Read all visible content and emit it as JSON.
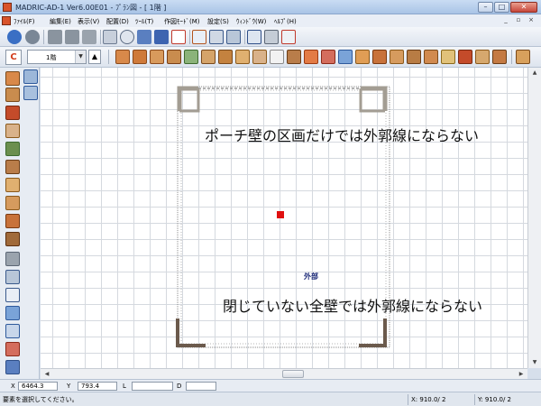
{
  "window": {
    "title": "MADRIC-AD-1 Ver6.00E01 - ﾌﾟﾗﾝ図 - [ 1階 ]",
    "minimize": "–",
    "maximize": "□",
    "close": "✕"
  },
  "menu": {
    "items": [
      "ﾌｧｲﾙ(F)",
      "編集(E)",
      "表示(V)",
      "配置(D)",
      "ﾂｰﾙ(T)",
      "作図ﾓｰﾄﾞ(M)",
      "設定(S)",
      "ｳｨﾝﾄﾞｳ(W)",
      "ﾍﾙﾌﾟ(H)"
    ],
    "mdi_minimize": "_",
    "mdi_restore": "▫",
    "mdi_close": "×"
  },
  "toolbar2": {
    "c_button": "C",
    "floor_value": "1階",
    "dropdown_arrow": "▼",
    "up_button": "▲"
  },
  "canvas": {
    "annotation_top": "ポーチ壁の区画だけでは外郭線にならない",
    "annotation_bottom": "閉じていない全壁では外郭線にならない",
    "room_label": "外部"
  },
  "coords": {
    "x_label": "X",
    "x_value": "6464.3",
    "y_label": "Y",
    "y_value": "793.4",
    "l_label": "L",
    "l_value": "",
    "d_label": "D",
    "d_value": ""
  },
  "status": {
    "message": "要素を選択してください。",
    "x_grid": "X: 910.0/ 2",
    "y_grid": "Y: 910.0/ 2"
  },
  "colors": {
    "porch_wall": "#a39d93",
    "full_wall": "#6b5a4c",
    "marker": "#e01010",
    "room_label": "#1c2a78"
  }
}
